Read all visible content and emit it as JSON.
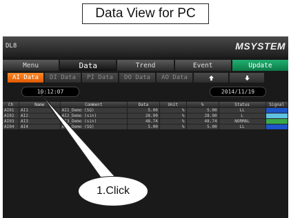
{
  "header_title": "Data View for PC",
  "device_label": "DL8",
  "brand": "MSYSTEM",
  "menu": [
    {
      "label": "Menu",
      "active": false
    },
    {
      "label": "Data",
      "active": true
    },
    {
      "label": "Trend",
      "active": false
    },
    {
      "label": "Event",
      "active": false
    },
    {
      "label": "Update",
      "active": false
    }
  ],
  "tabs": [
    {
      "label": "AI Data",
      "active": true
    },
    {
      "label": "DI Data",
      "active": false
    },
    {
      "label": "PI Data",
      "active": false
    },
    {
      "label": "DO Data",
      "active": false
    },
    {
      "label": "AO Data",
      "active": false
    }
  ],
  "arrow_up_icon": "up-arrow-icon",
  "arrow_down_icon": "down-arrow-icon",
  "time": "10:12:07",
  "date": "2014/11/19",
  "table": {
    "columns": [
      "Ch",
      "Name",
      "Comment",
      "Data",
      "Unit",
      "%",
      "Status",
      "Signal"
    ],
    "rows": [
      {
        "ch": "AI01",
        "name": "AI1",
        "comment": "AI1_Demo (SQ)",
        "data": "5.00",
        "unit": "%",
        "pct": "5.00",
        "status": "LL",
        "signal_color": "#1e55c8"
      },
      {
        "ch": "AI02",
        "name": "AI2",
        "comment": "AI2_Demo (sin)",
        "data": "28.90",
        "unit": "%",
        "pct": "28.90",
        "status": "L",
        "signal_color": "#5fc0e0"
      },
      {
        "ch": "AI03",
        "name": "AI3",
        "comment": "AI3_Demo (sin)",
        "data": "48.74",
        "unit": "%",
        "pct": "48.74",
        "status": "NORMAL",
        "signal_color": "#3aa84a"
      },
      {
        "ch": "AI04",
        "name": "AI4",
        "comment": "AI4_Demo (SQ)",
        "data": "5.00",
        "unit": "%",
        "pct": "5.00",
        "status": "LL",
        "signal_color": "#1e55c8"
      }
    ]
  },
  "callout": "1.Click"
}
